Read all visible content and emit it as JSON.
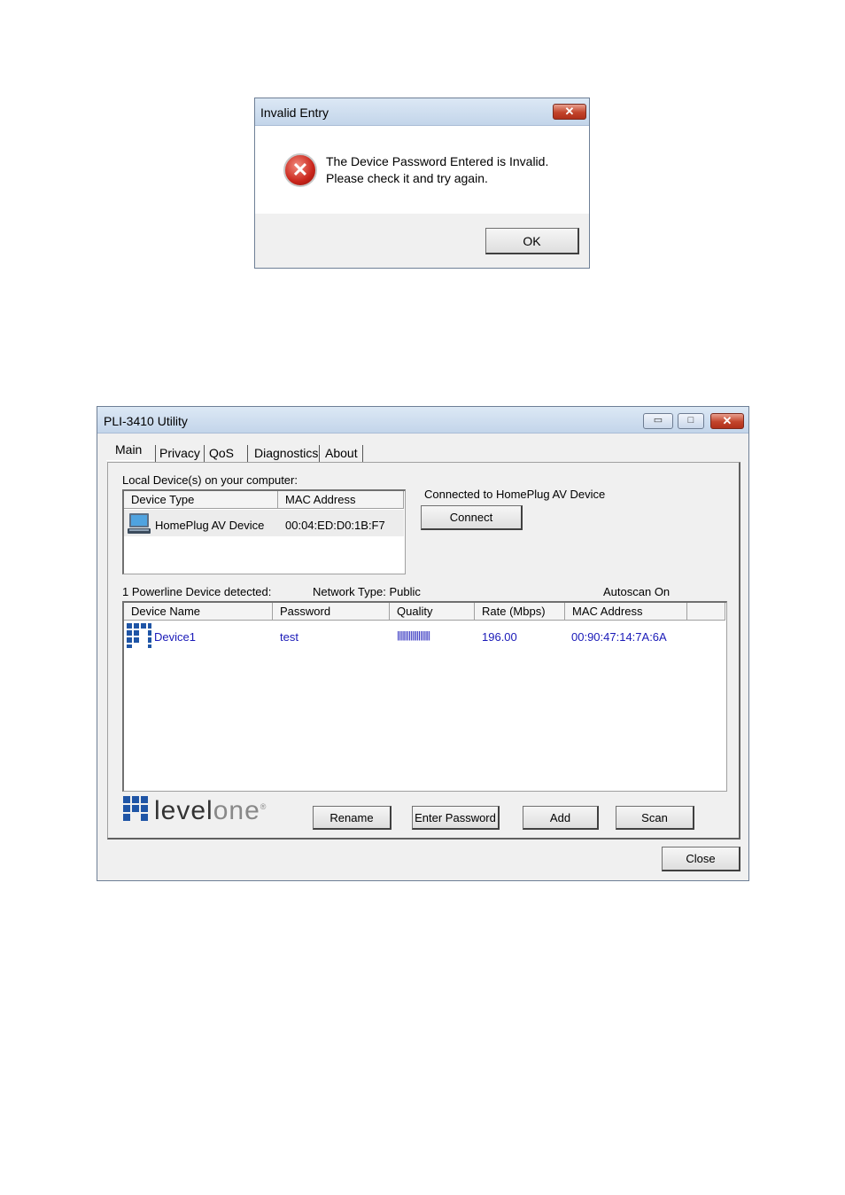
{
  "dialog": {
    "title": "Invalid Entry",
    "close_glyph": "✕",
    "message_line1": "The Device Password Entered is Invalid.",
    "message_line2": "Please check it and try again.",
    "icon": "error-icon",
    "ok_label": "OK"
  },
  "utility": {
    "title": "PLI-3410 Utility",
    "caption": {
      "minimize": "▭",
      "maximize": "□",
      "close": "✕"
    },
    "tabs": [
      "Main",
      "Privacy",
      "QoS",
      "Diagnostics",
      "About"
    ],
    "local_devices_label": "Local Device(s) on your computer:",
    "local_table": {
      "headers": [
        "Device Type",
        "MAC Address"
      ],
      "rows": [
        {
          "type": "HomePlug AV Device",
          "mac": "00:04:ED:D0:1B:F7",
          "icon": "computer-icon"
        }
      ]
    },
    "connected_label": "Connected to HomePlug AV Device",
    "connect_label": "Connect",
    "detected_label": "1 Powerline Device detected:",
    "network_type_label": "Network Type: Public",
    "autoscan_label": "Autoscan On",
    "remote_table": {
      "headers": [
        "Device Name",
        "Password",
        "Quality",
        "Rate (Mbps)",
        "MAC Address"
      ],
      "rows": [
        {
          "name": "Device1",
          "password": "test",
          "quality": "||||||||||||||||||||",
          "rate": "196.00",
          "mac": "00:90:47:14:7A:6A",
          "icon": "device-grid-icon"
        }
      ]
    },
    "logo_text_a": "level",
    "logo_text_b": "one",
    "logo_mark": "®",
    "buttons": {
      "rename": "Rename",
      "enter_password": "Enter Password",
      "add": "Add",
      "scan": "Scan",
      "close": "Close"
    },
    "colors": {
      "link_blue": "#1a1ab8",
      "logo_blue": "#1f55a6"
    }
  }
}
